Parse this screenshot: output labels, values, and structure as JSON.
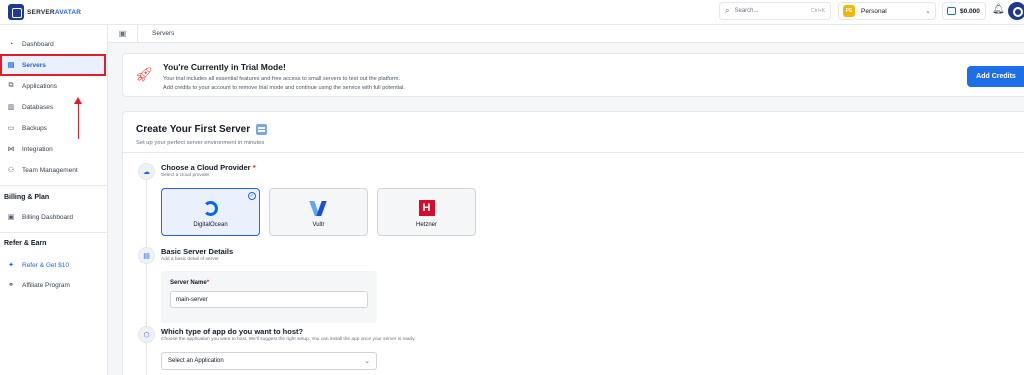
{
  "header": {
    "logo_part1": "SERVER",
    "logo_part2": "AVATAR",
    "search_placeholder": "Search...",
    "search_shortcut": "Ctrl+K",
    "workspace_initials": "PE",
    "workspace_name": "Personal",
    "wallet_balance": "$0.000"
  },
  "sidebar": {
    "items": [
      {
        "label": "Dashboard",
        "icon": "dashboard-icon"
      },
      {
        "label": "Servers",
        "icon": "server-icon"
      },
      {
        "label": "Applications",
        "icon": "apps-icon"
      },
      {
        "label": "Databases",
        "icon": "database-icon"
      },
      {
        "label": "Backups",
        "icon": "backup-icon"
      },
      {
        "label": "Integration",
        "icon": "integration-icon"
      },
      {
        "label": "Team Management",
        "icon": "team-icon"
      }
    ],
    "billing_heading": "Billing & Plan",
    "billing_items": [
      {
        "label": "Billing Dashboard",
        "icon": "billing-icon"
      }
    ],
    "refer_heading": "Refer & Earn",
    "refer_items": [
      {
        "label": "Refer & Get $10",
        "icon": "gift-icon"
      },
      {
        "label": "Affiliate Program",
        "icon": "handshake-icon"
      }
    ]
  },
  "breadcrumb": {
    "current": "Servers"
  },
  "banner": {
    "title": "You're Currently in Trial Mode!",
    "line1": "Your trial includes all essential features and free access to small servers to test out the platform.",
    "line2": "Add credits to your account to remove trial mode and continue using the service with full potential.",
    "button": "Add Credits"
  },
  "create": {
    "title": "Create Your First Server",
    "subtitle": "Set up your perfect server environment in minutes",
    "step1": {
      "title": "Choose a Cloud Provider",
      "required_mark": "*",
      "subtitle": "Select a cloud provider",
      "providers": [
        {
          "name": "DigitalOcean",
          "selected": true
        },
        {
          "name": "Vultr",
          "selected": false
        },
        {
          "name": "Hetzner",
          "selected": false
        }
      ]
    },
    "step2": {
      "title": "Basic Server Details",
      "subtitle": "Add a basic detail of server",
      "field_label": "Server Name",
      "required_mark": "*",
      "field_value": "main-server"
    },
    "step3": {
      "title": "Which type of app do you want to host?",
      "subtitle": "Choose the application you want to host. We'll suggest the right setup. You can install the app once your server is ready.",
      "select_value": "Select an Application"
    }
  },
  "colors": {
    "accent": "#1d6fe8",
    "highlight": "#e11d2a",
    "brand": "#1f3b8f"
  }
}
